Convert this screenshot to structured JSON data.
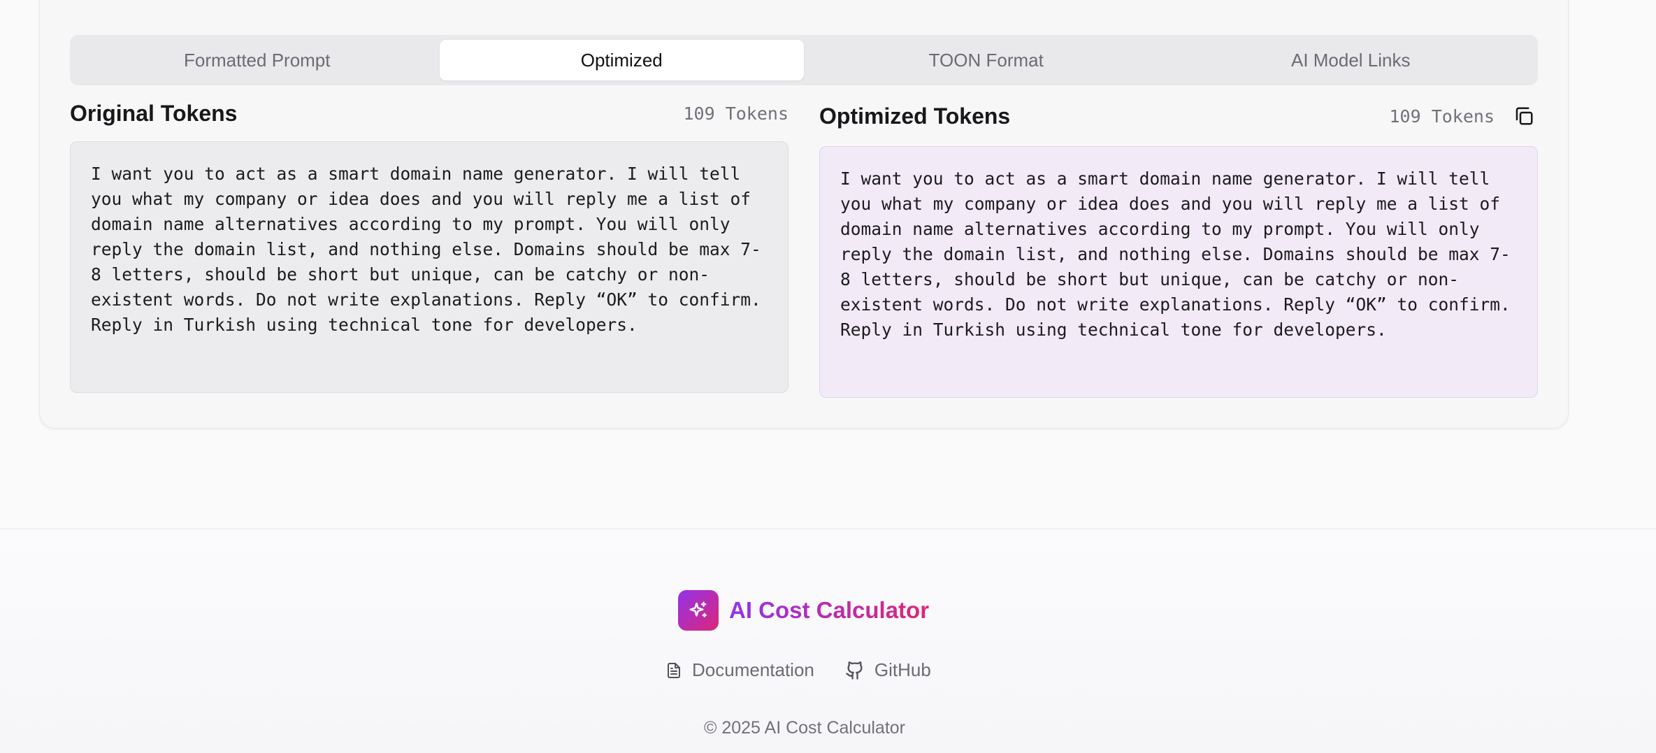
{
  "tabs": [
    {
      "label": "Formatted Prompt",
      "active": false
    },
    {
      "label": "Optimized",
      "active": true
    },
    {
      "label": "TOON Format",
      "active": false
    },
    {
      "label": "AI Model Links",
      "active": false
    }
  ],
  "original": {
    "title": "Original Tokens",
    "token_count": "109 Tokens",
    "text": "I want you to act as a smart domain name generator. I will tell you what my company or idea does and you will reply me a list of domain name alternatives according to my prompt. You will only reply the domain list, and nothing else. Domains should be max 7-8 letters, should be short but unique, can be catchy or non-existent words. Do not write explanations. Reply “OK” to confirm. Reply in Turkish using technical tone for developers."
  },
  "optimized": {
    "title": "Optimized Tokens",
    "token_count": "109 Tokens",
    "copy_icon": "copy-icon",
    "text": "I want you to act as a smart domain name generator. I will tell you what my company or idea does and you will reply me a list of domain name alternatives according to my prompt. You will only reply the domain list, and nothing else. Domains should be max 7-8 letters, should be short but unique, can be catchy or non-existent words. Do not write explanations. Reply “OK” to confirm. Reply in Turkish using technical tone for developers."
  },
  "footer": {
    "brand_name": "AI Cost Calculator",
    "brand_icon": "sparkles-icon",
    "links": [
      {
        "label": "Documentation",
        "icon": "document-icon"
      },
      {
        "label": "GitHub",
        "icon": "github-icon"
      }
    ],
    "copyright": "© 2025 AI Cost Calculator"
  },
  "colors": {
    "accent": "#9333ea",
    "accent_end": "#db2777",
    "optimized_bg": "#f2eaf7"
  }
}
